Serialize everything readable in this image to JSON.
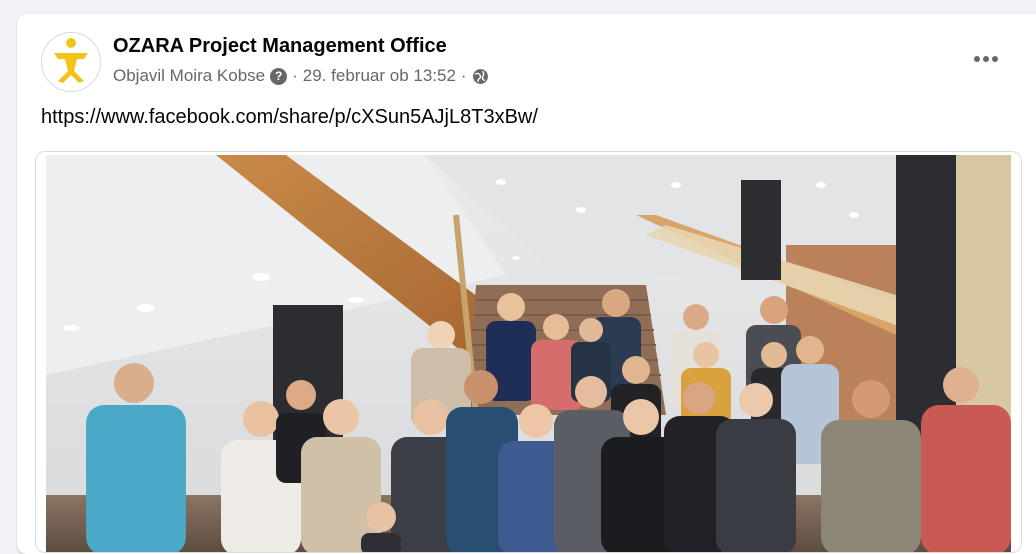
{
  "post": {
    "page_name": "OZARA Project Management Office",
    "author_prefix": "Objavil Moira Kobse",
    "date": "29. februar ob 13:52",
    "separator": "·",
    "privacy_icon": "globe-icon",
    "link_text": "https://www.facebook.com/share/p/cXSun5AJjL8T3xBw/"
  },
  "icons": {
    "more": "more-options-icon",
    "info": "question-icon"
  },
  "colors": {
    "text": "#050505",
    "secondary": "#65676b",
    "logo_yellow": "#f2c318",
    "background": "#f0f2f5"
  }
}
